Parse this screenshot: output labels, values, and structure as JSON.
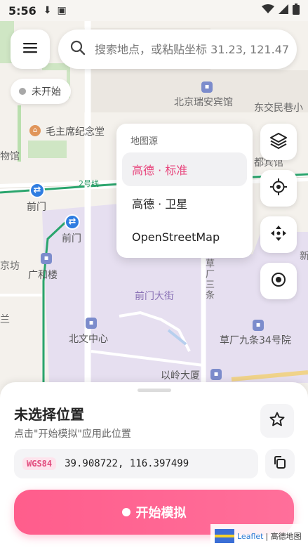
{
  "status_bar": {
    "time": "5:56"
  },
  "search": {
    "placeholder": "搜索地点，或粘贴坐标 31.23, 121.47"
  },
  "status_chip": {
    "label": "未开始"
  },
  "layer_menu": {
    "title": "地图源",
    "items": [
      {
        "label": "高德 · 标准",
        "active": true
      },
      {
        "label": "高德 · 卫星",
        "active": false
      },
      {
        "label": "OpenStreetMap",
        "active": false
      }
    ]
  },
  "map_labels": {
    "ruian": "北京瑞安宾馆",
    "dongjiao": "东交民巷小",
    "mausoleum": "毛主席纪念堂",
    "wuguan": "物馆",
    "duibinguan": "都宾馆",
    "line2": "2号线",
    "qianmen1": "前门",
    "qianmen2": "前门",
    "jingfang": "京坊",
    "guangheylou": "广和楼",
    "qianmendajie": "前门大街",
    "caochang": "草厂三条",
    "beiwen": "北文中心",
    "caochang34": "草厂九条34号院",
    "yiling": "以岭大厦",
    "lan": "兰",
    "xin": "新"
  },
  "sheet": {
    "title": "未选择位置",
    "hint": "点击\"开始模拟\"应用此位置",
    "coord_system": "WGS84",
    "coordinates": "39.908722, 116.397499",
    "start_label": "开始模拟"
  },
  "attribution": {
    "leaflet": "Leaflet",
    "provider": "| 高德地图"
  }
}
